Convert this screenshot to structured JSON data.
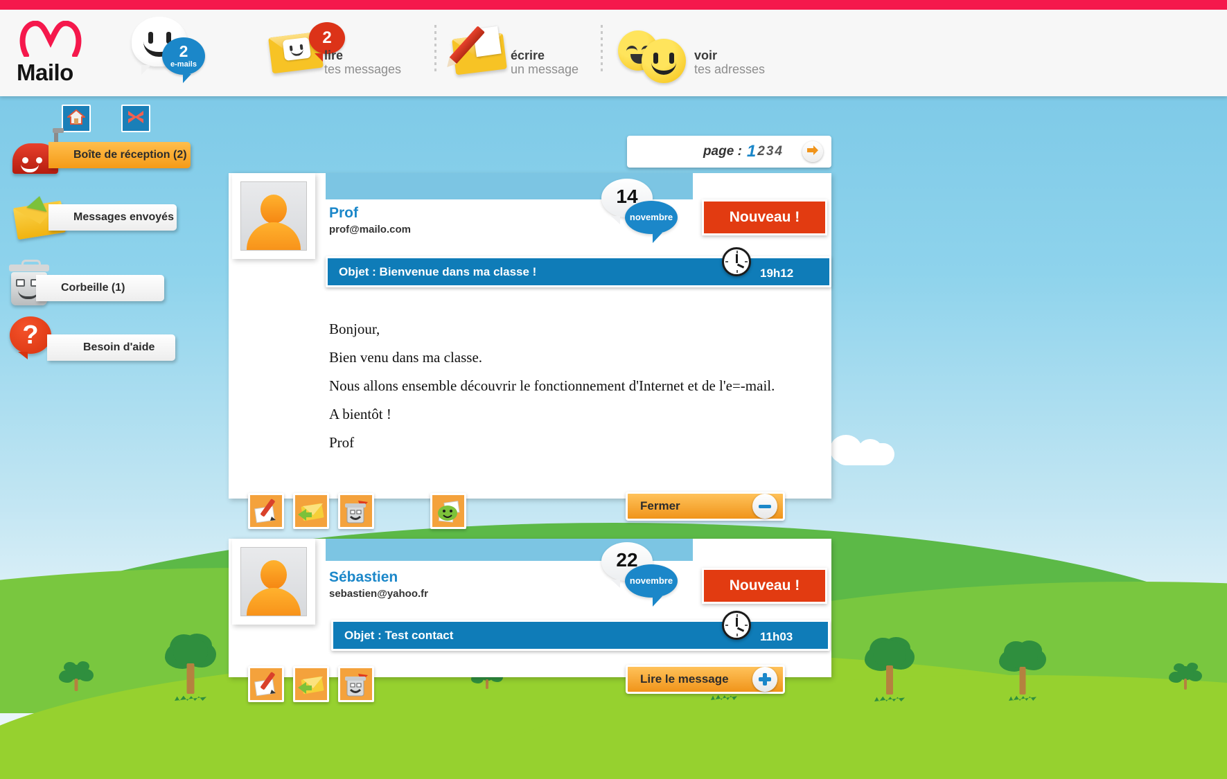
{
  "brand": {
    "name": "Mailo"
  },
  "topnav": {
    "emails_badge": {
      "count": "2",
      "label": "e-mails"
    },
    "items": [
      {
        "id": "lire",
        "badge": "2",
        "line1": "lire",
        "line2": "tes messages"
      },
      {
        "id": "ecrire",
        "badge": "",
        "line1": "écrire",
        "line2": "un message"
      },
      {
        "id": "adresses",
        "badge": "",
        "line1": "voir",
        "line2": "tes adresses"
      }
    ]
  },
  "sidebar": {
    "quick_icons": [
      {
        "id": "home",
        "icon": "home-icon"
      },
      {
        "id": "close",
        "icon": "close-x-icon"
      }
    ],
    "items": [
      {
        "id": "inbox",
        "label": "Boîte de réception (2)",
        "active": true
      },
      {
        "id": "sent",
        "label": "Messages envoyés",
        "active": false
      },
      {
        "id": "trash",
        "label": "Corbeille (1)",
        "active": false
      },
      {
        "id": "help",
        "label": "Besoin d'aide",
        "active": false
      }
    ]
  },
  "pager": {
    "label": "page :",
    "pages": [
      "1",
      "2",
      "3",
      "4"
    ],
    "current": "1",
    "next_icon": "arrow-right-icon"
  },
  "messages": [
    {
      "sender_name": "Prof",
      "sender_email": "prof@mailo.com",
      "day": "14",
      "month": "novembre",
      "status_label": "Nouveau !",
      "subject": "Objet : Bienvenue dans ma classe !",
      "time": "19h12",
      "expanded": true,
      "body": [
        "Bonjour,",
        "Bien venu dans ma classe.",
        "Nous allons ensemble découvrir le fonctionnement d'Internet et de l'e=-mail.",
        "A bientôt !",
        "Prof"
      ],
      "actions": [
        {
          "id": "reply",
          "icon": "reply-pencil-icon"
        },
        {
          "id": "forward",
          "icon": "forward-envelope-icon"
        },
        {
          "id": "delete",
          "icon": "trash-icon"
        },
        {
          "id": "attachment",
          "icon": "attachment-icon"
        }
      ],
      "toggle_label": "Fermer",
      "toggle_icon": "minus-icon"
    },
    {
      "sender_name": "Sébastien",
      "sender_email": "sebastien@yahoo.fr",
      "day": "22",
      "month": "novembre",
      "status_label": "Nouveau !",
      "subject": "Objet :  Test contact",
      "time": "11h03",
      "expanded": false,
      "body": [],
      "actions": [
        {
          "id": "reply",
          "icon": "reply-pencil-icon"
        },
        {
          "id": "forward",
          "icon": "forward-envelope-icon"
        },
        {
          "id": "delete",
          "icon": "trash-icon"
        }
      ],
      "toggle_label": "Lire le message",
      "toggle_icon": "plus-icon"
    }
  ],
  "colors": {
    "brand_red": "#f5184c",
    "accent_blue": "#1b87c9",
    "subject_blue": "#0f7cb8",
    "new_red": "#e23b11",
    "orange": "#f0941a",
    "sky": "#8ecfe8",
    "grass": "#96d12f"
  }
}
